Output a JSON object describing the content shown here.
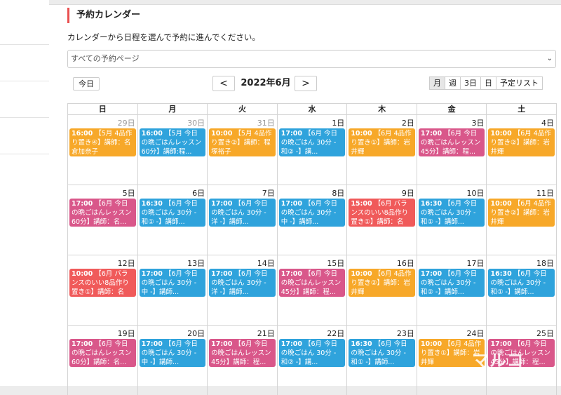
{
  "page": {
    "title": "予約カレンダー",
    "description": "カレンダーから日程を選んで予約に進んでください。"
  },
  "select": {
    "value": "すべての予約ページ"
  },
  "toolbar": {
    "today": "今日",
    "prev": "<",
    "next": ">",
    "month": "2022年6月",
    "views": [
      "月",
      "週",
      "3日",
      "日",
      "予定リスト"
    ],
    "active_view": "月"
  },
  "weekdays": [
    "日",
    "月",
    "火",
    "水",
    "木",
    "金",
    "土"
  ],
  "weeks": [
    [
      {
        "day": "29日",
        "other": true,
        "event": {
          "time": "16:00",
          "title": "【5月 4品作り置き④】講師：名倉加奈子",
          "color": "orange"
        }
      },
      {
        "day": "30日",
        "other": true,
        "event": {
          "time": "16:00",
          "title": "【5月 今日の晩ごはんレッスン 60分】講師:程...",
          "color": "blue"
        }
      },
      {
        "day": "31日",
        "other": true,
        "event": {
          "time": "10:00",
          "title": "【5月 4品作り置き②】講師：程塚裕子",
          "color": "orange"
        }
      },
      {
        "day": "1日",
        "other": false,
        "event": {
          "time": "17:00",
          "title": "【6月 今日の晩ごはん 30分 - 和② -】講...",
          "color": "blue"
        }
      },
      {
        "day": "2日",
        "other": false,
        "event": {
          "time": "10:00",
          "title": "【6月 4品作り置き①】講師：岩井輝",
          "color": "orange"
        }
      },
      {
        "day": "3日",
        "other": false,
        "event": {
          "time": "17:00",
          "title": "【6月 今日の晩ごはんレッスン 45分】講師：程...",
          "color": "pink"
        }
      },
      {
        "day": "4日",
        "other": false,
        "event": {
          "time": "10:00",
          "title": "【6月 4品作り置き②】講師：岩井輝",
          "color": "orange"
        }
      }
    ],
    [
      {
        "day": "5日",
        "other": false,
        "event": {
          "time": "17:00",
          "title": "【6月 今日の晩ごはんレッスン 60分】講師：名...",
          "color": "pink"
        }
      },
      {
        "day": "6日",
        "other": false,
        "event": {
          "time": "16:30",
          "title": "【6月 今日の晩ごはん 30分 - 和① -】講師...",
          "color": "blue"
        }
      },
      {
        "day": "7日",
        "other": false,
        "event": {
          "time": "17:00",
          "title": "【6月 今日の晩ごはん 30分 - 洋 -】講師...",
          "color": "blue"
        }
      },
      {
        "day": "8日",
        "other": false,
        "event": {
          "time": "17:00",
          "title": "【6月 今日の晩ごはん 30分 - 中 -】講師...",
          "color": "blue"
        }
      },
      {
        "day": "9日",
        "other": false,
        "event": {
          "time": "15:00",
          "title": "【6月 バランスのいい8品作り置き①】講師：名倉...",
          "color": "red"
        }
      },
      {
        "day": "10日",
        "other": false,
        "event": {
          "time": "16:30",
          "title": "【6月 今日の晩ごはん 30分 - 和① -】講師...",
          "color": "blue"
        }
      },
      {
        "day": "11日",
        "other": false,
        "event": {
          "time": "10:00",
          "title": "【6月 4品作り置き②】講師：岩井輝",
          "color": "orange"
        }
      }
    ],
    [
      {
        "day": "12日",
        "other": false,
        "event": {
          "time": "10:00",
          "title": "【6月 バランスのいい8品作り置き①】講師：名倉...",
          "color": "red"
        }
      },
      {
        "day": "13日",
        "other": false,
        "event": {
          "time": "17:00",
          "title": "【6月 今日の晩ごはん 30分 - 中 -】講師...",
          "color": "blue"
        }
      },
      {
        "day": "14日",
        "other": false,
        "event": {
          "time": "17:00",
          "title": "【6月 今日の晩ごはん 30分 - 洋 -】講師...",
          "color": "blue"
        }
      },
      {
        "day": "15日",
        "other": false,
        "event": {
          "time": "17:00",
          "title": "【6月 今日の晩ごはんレッスン 45分】講師：程...",
          "color": "pink"
        }
      },
      {
        "day": "16日",
        "other": false,
        "event": {
          "time": "10:00",
          "title": "【6月 4品作り置き②】講師：岩井輝",
          "color": "orange"
        }
      },
      {
        "day": "17日",
        "other": false,
        "event": {
          "time": "17:00",
          "title": "【6月 今日の晩ごはん 30分 - 和② -】講師...",
          "color": "blue"
        }
      },
      {
        "day": "18日",
        "other": false,
        "event": {
          "time": "16:30",
          "title": "【6月 今日の晩ごはん 30分 - 和① -】講師...",
          "color": "blue"
        }
      }
    ],
    [
      {
        "day": "19日",
        "other": false,
        "event": {
          "time": "17:00",
          "title": "【6月 今日の晩ごはんレッスン 60分】講師：名...",
          "color": "pink"
        }
      },
      {
        "day": "20日",
        "other": false,
        "event": {
          "time": "17:00",
          "title": "【6月 今日の晩ごはん 30分 - 中 -】講師...",
          "color": "blue"
        }
      },
      {
        "day": "21日",
        "other": false,
        "event": {
          "time": "17:00",
          "title": "【6月 今日の晩ごはんレッスン 45分】講師：程...",
          "color": "pink"
        }
      },
      {
        "day": "22日",
        "other": false,
        "event": {
          "time": "17:00",
          "title": "【6月 今日の晩ごはん 30分 - 和② -】講...",
          "color": "blue"
        }
      },
      {
        "day": "23日",
        "other": false,
        "event": {
          "time": "16:30",
          "title": "【6月 今日の晩ごはん 30分 - 和① -】講師...",
          "color": "blue"
        }
      },
      {
        "day": "24日",
        "other": false,
        "event": {
          "time": "10:00",
          "title": "【6月 4品作り置き①】講師：岩井輝",
          "color": "orange"
        }
      },
      {
        "day": "25日",
        "other": false,
        "event": {
          "time": "17:00",
          "title": "【6月 今日の晩ごはんレッスン 45分】講師：程...",
          "color": "pink"
        }
      }
    ]
  ],
  "watermark": "マルコ",
  "colors": {
    "orange": "#f7a829",
    "pink": "#d9578a",
    "blue": "#2fa3dc",
    "red": "#f05a5a",
    "accent": "#e94f4f"
  }
}
